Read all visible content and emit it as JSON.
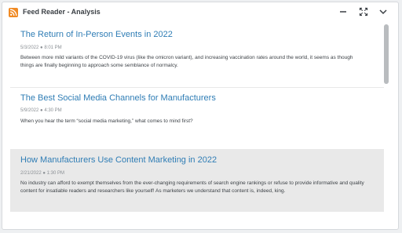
{
  "widget": {
    "title": "Feed Reader - Analysis",
    "icons": {
      "feed": "rss-icon",
      "minimize": "minimize-icon",
      "expand": "expand-icon",
      "collapse": "chevron-down-icon"
    },
    "accent_color": "#f08a24",
    "link_color": "#2f7db5"
  },
  "items": [
    {
      "title": "The Return of In-Person Events in 2022",
      "meta": "5/3/2022 ● 8:01 PM",
      "body": "Between more mild variants of the COVID-19 virus (like the omicron variant), and increasing vaccination rates around the world, it seems as though things are finally beginning to approach some semblance of normalcy."
    },
    {
      "title": "The Best Social Media Channels for Manufacturers",
      "meta": "5/9/2022 ● 4:30 PM",
      "body": "When you hear the term “social media marketing,” what comes to mind first?"
    },
    {
      "title": "How Manufacturers Use Content Marketing in 2022",
      "meta": "2/21/2022 ● 1:30 PM",
      "body": "No industry can afford to exempt themselves from the ever-changing requirements of search engine rankings or refuse to provide informative and quality content for insatiable readers and researchers like yourself! As marketers we understand that content is, indeed, king."
    }
  ]
}
